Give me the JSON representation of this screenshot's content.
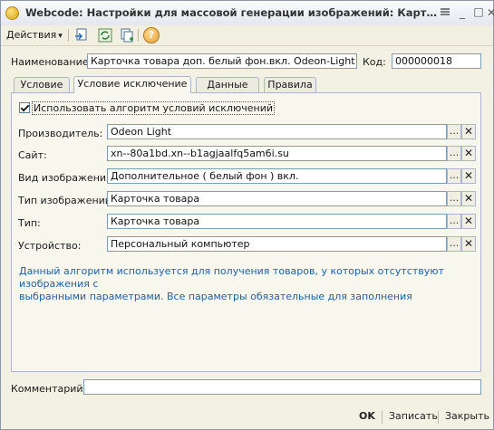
{
  "window": {
    "title": "Webcode: Настройки для массовой генерации изображений: Карточка то...",
    "min_label": "_",
    "max_label": "□",
    "close_label": "✕"
  },
  "toolbar": {
    "actions_label": "Действия",
    "actions_arrow": "▾",
    "help_label": "?"
  },
  "header": {
    "name_label": "Наименование:",
    "name_value": "Карточка товара доп. белый фон.вкл. Odeon-Light",
    "code_label": "Код:",
    "code_value": "000000018"
  },
  "tabs": [
    {
      "label": "Условие"
    },
    {
      "label": "Условие исключение"
    },
    {
      "label": "Данные"
    },
    {
      "label": "Правила"
    }
  ],
  "panel": {
    "use_algorithm_label": "Использовать алгоритм условий исключений",
    "use_algorithm_checked": true,
    "fields": [
      {
        "label": "Производитель:",
        "value": "Odeon Light"
      },
      {
        "label": "Сайт:",
        "value": "xn--80a1bd.xn--b1agjaalfq5am6i.su"
      },
      {
        "label": "Вид изображения:",
        "value": "Дополнительное ( белый фон ) вкл."
      },
      {
        "label": "Тип изображений:",
        "value": "Карточка товара"
      },
      {
        "label": "Тип:",
        "value": "Карточка товара"
      },
      {
        "label": "Устройство:",
        "value": "Персональный компьютер"
      }
    ],
    "select_button": "...",
    "clear_button": "✕",
    "info_line1": "Данный алгоритм используется для получения товаров, у которых отсутствуют изображения с",
    "info_line2": "выбранными параметрами. Все параметры обязательные для заполнения"
  },
  "comment": {
    "label": "Комментарий:",
    "value": ""
  },
  "footer": {
    "ok_label": "OK",
    "save_label": "Записать",
    "close_label": "Закрыть"
  }
}
